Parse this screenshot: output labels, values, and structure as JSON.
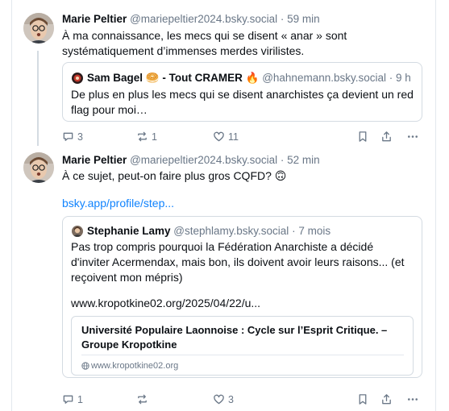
{
  "posts": [
    {
      "author": "Marie Peltier",
      "handle": "@mariepeltier2024.bsky.social",
      "separator": "·",
      "time": "59 min",
      "text": "À ma connaissance, les mecs qui se disent « anar » sont systématiquement d’immenses merdes virilistes.",
      "quote": {
        "author": "Sam Bagel",
        "author_emoji": "🥯",
        "author_suffix": "- Tout CRAMER",
        "author_suffix_emoji": "🔥",
        "handle": "@hahnemann.bsky.social",
        "separator": "·",
        "time": "9 h",
        "text": "De plus en plus les mecs qui se disent anarchistes ça devient un red flag pour moi…"
      },
      "actions": {
        "replies": "3",
        "reposts": "1",
        "likes": "11"
      }
    },
    {
      "author": "Marie Peltier",
      "handle": "@mariepeltier2024.bsky.social",
      "separator": "·",
      "time": "52 min",
      "text": "À ce sujet, peut-on faire plus gros CQFD? 🙃",
      "link": "bsky.app/profile/step...",
      "quote": {
        "author": "Stephanie Lamy",
        "handle": "@stephlamy.bsky.social",
        "separator": "·",
        "time": "7 mois",
        "text": "Pas trop compris pourquoi la Fédération Anarchiste a décidé d'inviter Acermendax, mais bon, ils doivent avoir leurs raisons... (et reçoivent mon mépris)",
        "link": "www.kropotkine02.org/2025/04/22/u...",
        "card": {
          "title": "Université Populaire Laonnoise : Cycle sur l’Esprit Critique. – Groupe Kropotkine",
          "domain": "www.kropotkine02.org"
        }
      },
      "actions": {
        "replies": "1",
        "reposts": "",
        "likes": "3"
      }
    }
  ],
  "icons": [
    "reply-icon",
    "repost-icon",
    "like-icon",
    "bookmark-icon",
    "share-icon",
    "more-icon",
    "globe-icon"
  ],
  "colors": {
    "link": "#1083fe",
    "muted": "#6a7787",
    "border": "#d4dbe2"
  }
}
